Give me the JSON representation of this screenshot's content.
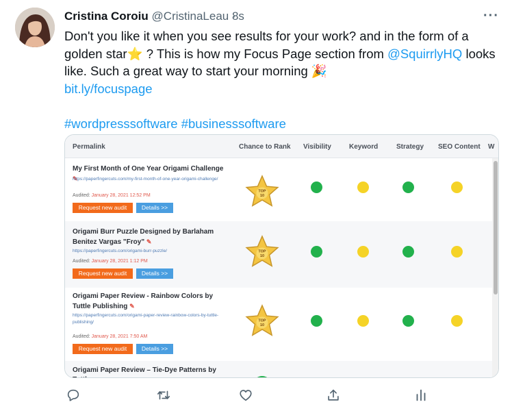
{
  "tweet": {
    "name": "Cristina Coroiu",
    "handle": "@CristinaLeau",
    "separator": "·",
    "time": "8s",
    "more": "···",
    "text_1": "Don't you like it when you see results for your work? and in the form of a golden star",
    "star_emoji": "⭐",
    "text_2": "? This is how my Focus Page section from",
    "mention": "@SquirrlyHQ",
    "text_3": "looks like. Such a great way to start your morning",
    "party_emoji": "🎉",
    "url": "bit.ly/focuspage",
    "hashtag_1": "#wordpresssoftware",
    "hashtag_2": "#businesssoftware"
  },
  "table": {
    "headers": [
      "Permalink",
      "Chance to Rank",
      "Visibility",
      "Keyword",
      "Strategy",
      "SEO Content",
      "W"
    ],
    "audited_label": "Audited:",
    "audit_button": "Request new audit",
    "details_button": "Details >>",
    "star_label": "TOP 10",
    "rows": [
      {
        "title": "My First Month of One Year Origami Challenge",
        "url": "https://paperfingercuts.com/my-first-month-of-one-year-origami-challenge/",
        "date": "January 28, 2021 12:52 PM",
        "statuses": [
          "green",
          "yellow",
          "green",
          "yellow"
        ]
      },
      {
        "title": "Origami Burr Puzzle Designed by Barlaham Benitez Vargas \"Froy\"",
        "url": "https://paperfingercuts.com/origami-burr-puzzle/",
        "date": "January 28, 2021 1:12 PM",
        "statuses": [
          "green",
          "yellow",
          "green",
          "yellow"
        ]
      },
      {
        "title": "Origami Paper Review - Rainbow Colors by Tuttle Publishing",
        "url": "https://paperfingercuts.com/origami-paper-review-rainbow-colors-by-tuttle-publishing/",
        "date": "January 28, 2021 7:50 AM",
        "statuses": [
          "green",
          "yellow",
          "green",
          "yellow"
        ]
      },
      {
        "title": "Origami Paper Review – Tie-Dye Patterns by Tuttle"
      }
    ]
  },
  "colors": {
    "link": "#1d9bf0",
    "green": "#22b14c",
    "yellow": "#f5d327",
    "audit_button": "#f26a1b",
    "details_button": "#4a9ee0"
  },
  "actions": [
    "reply-icon",
    "retweet-icon",
    "like-icon",
    "share-icon",
    "analytics-icon"
  ]
}
